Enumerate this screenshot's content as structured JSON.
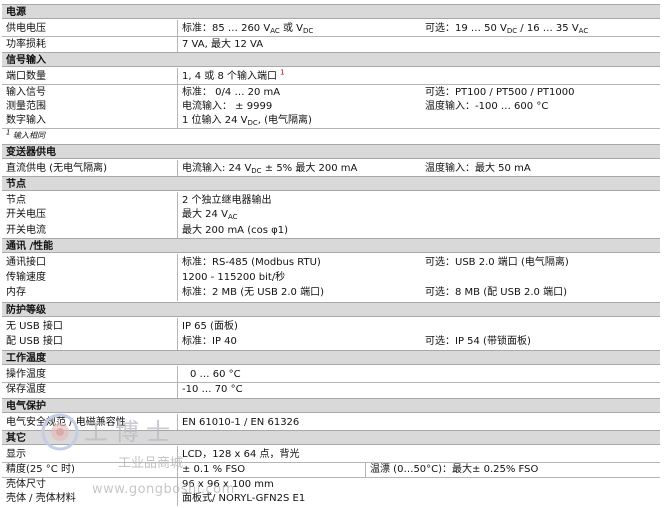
{
  "sections": {
    "power": "电源",
    "signal": "信号输入",
    "transmitter": "变送器供电",
    "relay": "节点",
    "comm": "通讯 /性能",
    "protection": "防护等级",
    "temperature": "工作温度",
    "safety": "电气保护",
    "other": "其它"
  },
  "power": {
    "supply_label": "供电电压",
    "supply_std_a": "标准：85 … 260 V",
    "supply_std_sub_a": "AC",
    "supply_std_b": " 或 V",
    "supply_std_sub_b": "DC",
    "supply_opt_a": "可选：19 … 50 V",
    "supply_opt_sub_a": "DC",
    "supply_opt_b": " / 16 … 35 V",
    "supply_opt_sub_b": "AC",
    "loss_label": "功率损耗",
    "loss_value": "7 VA, 最大 12 VA"
  },
  "signal": {
    "ports_label": "端口数量",
    "ports_value": "1, 4 或 8 个输入端口",
    "ports_sup": "1",
    "input_label": "输入信号",
    "input_std": "标准：   0/4 … 20 mA",
    "input_opt": "可选：PT100 / PT500 / PT1000",
    "range_label": "测量范围",
    "range_current": "电流输入：   ± 9999",
    "range_temp": "温度输入：-100 … 600 °C",
    "digital_label": "数字输入",
    "digital_value_a": "1 位输入  24 V",
    "digital_value_sub": "DC",
    "digital_value_b": ", (电气隔离)",
    "footnote_sup": "1",
    "footnote_text": "输入相同"
  },
  "transmitter": {
    "dc_label": "直流供电 (无电气隔离)",
    "dc_current_a": "电流输入: 24 V",
    "dc_current_sub": "DC",
    "dc_current_b": " ± 5%  最大 200 mA",
    "dc_temp": "温度输入：最大 50 mA"
  },
  "relay": {
    "node_label": "节点",
    "node_value": "2 个独立继电器输出",
    "voltage_label": "开关电压",
    "voltage_value_a": "最大 24 V",
    "voltage_value_sub": "AC",
    "current_label": "开关电流",
    "current_value": "最大  200 mA (cos φ1)"
  },
  "comm": {
    "interface_label": "通讯接口",
    "interface_std": "标准：RS-485 (Modbus RTU)",
    "interface_opt": "可选：USB 2.0 端口 (电气隔离)",
    "speed_label": "传输速度",
    "speed_value": "1200 - 115200 bit/秒",
    "memory_label": "内存",
    "memory_std": "标准：2 MB (无  USB 2.0 端口)",
    "memory_opt": "可选：8 MB (配 USB 2.0 端口)"
  },
  "protection": {
    "nousb_label": "无 USB 接口",
    "nousb_value": "IP 65 (面板)",
    "usb_label": "配 USB 接口",
    "usb_std": "标准：IP 40",
    "usb_opt": "可选：IP 54 (带锁面板)"
  },
  "temperature": {
    "op_label": "操作温度",
    "op_value": "0 … 60 °C",
    "store_label": "保存温度",
    "store_value": "-10 … 70 °C"
  },
  "safety": {
    "emc_label": "电气安全规范 / 电磁兼容性",
    "emc_value": "EN 61010-1 / EN 61326"
  },
  "other": {
    "display_label": "显示",
    "display_value": "LCD，128 x 64 点，背光",
    "accuracy_label": "精度(25 °C 时)",
    "accuracy_value": "± 0.1 % FSO",
    "drift_value": "温漂 (0…50°C)：最大± 0.25% FSO",
    "size_label": "壳体尺寸",
    "size_value": "96 x 96 x 100 mm",
    "material_label": "壳体 / 壳体材料",
    "material_value": "面板式/ NORYL-GFN2S E1"
  },
  "watermark": {
    "brand": "工博士",
    "site_cn": "工业品商城",
    "url": "www.gongboshi.com"
  }
}
